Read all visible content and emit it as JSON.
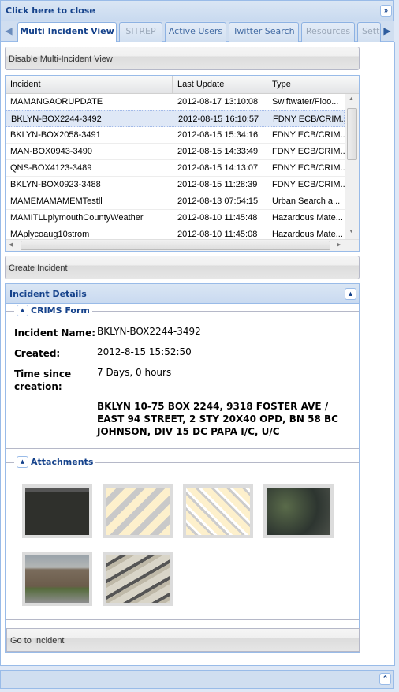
{
  "header": {
    "title": "Click here to close",
    "collapse_icon": "double-chevron-right"
  },
  "tabs": [
    {
      "label": "Multi Incident View",
      "state": "active"
    },
    {
      "label": "SITREP",
      "state": "disabled"
    },
    {
      "label": "Active Users",
      "state": "normal"
    },
    {
      "label": "Twitter Search",
      "state": "normal"
    },
    {
      "label": "Resources",
      "state": "disabled"
    },
    {
      "label": "Sett",
      "state": "disabled"
    }
  ],
  "buttons": {
    "disable_multi": "Disable Multi-Incident View",
    "create_incident": "Create Incident",
    "go_to_incident": "Go to Incident"
  },
  "grid": {
    "columns": [
      "Incident",
      "Last Update",
      "Type"
    ],
    "rows": [
      {
        "incident": "MAMANGAORUPDATE",
        "last_update": "2012-08-17 13:10:08",
        "type": "Swiftwater/Floo..."
      },
      {
        "incident": "BKLYN-BOX2244-3492",
        "last_update": "2012-08-15 16:10:57",
        "type": "FDNY ECB/CRIM...",
        "selected": true
      },
      {
        "incident": "BKLYN-BOX2058-3491",
        "last_update": "2012-08-15 15:34:16",
        "type": "FDNY ECB/CRIM..."
      },
      {
        "incident": "MAN-BOX0943-3490",
        "last_update": "2012-08-15 14:33:49",
        "type": "FDNY ECB/CRIM..."
      },
      {
        "incident": "QNS-BOX4123-3489",
        "last_update": "2012-08-15 14:13:07",
        "type": "FDNY ECB/CRIM..."
      },
      {
        "incident": "BKLYN-BOX0923-3488",
        "last_update": "2012-08-15 11:28:39",
        "type": "FDNY ECB/CRIM..."
      },
      {
        "incident": "MAMEMAMAMEMTestll",
        "last_update": "2012-08-13 07:54:15",
        "type": "Urban Search a..."
      },
      {
        "incident": "MAMITLLplymouthCountyWeather",
        "last_update": "2012-08-10 11:45:48",
        "type": "Hazardous Mate..."
      },
      {
        "incident": "MAplycoaug10strom",
        "last_update": "2012-08-10 11:45:08",
        "type": "Hazardous Mate..."
      }
    ]
  },
  "details": {
    "title": "Incident Details",
    "crims": {
      "legend": "CRIMS Form",
      "name_label": "Incident Name:",
      "name": "BKLYN-BOX2244-3492",
      "created_label": "Created:",
      "created": "2012-8-15 15:52:50",
      "since_label_1": "Time since",
      "since_label_2": "creation:",
      "since": "7 Days, 0 hours",
      "description": "BKLYN 10-75 BOX 2244, 9318 FOSTER AVE / EAST 94 STREET, 2 STY 20X40 OPD, BN 58 BC JOHNSON, DIV 15 DC PAPA I/C, U/C"
    },
    "attachments": {
      "legend": "Attachments",
      "count": 6
    }
  }
}
